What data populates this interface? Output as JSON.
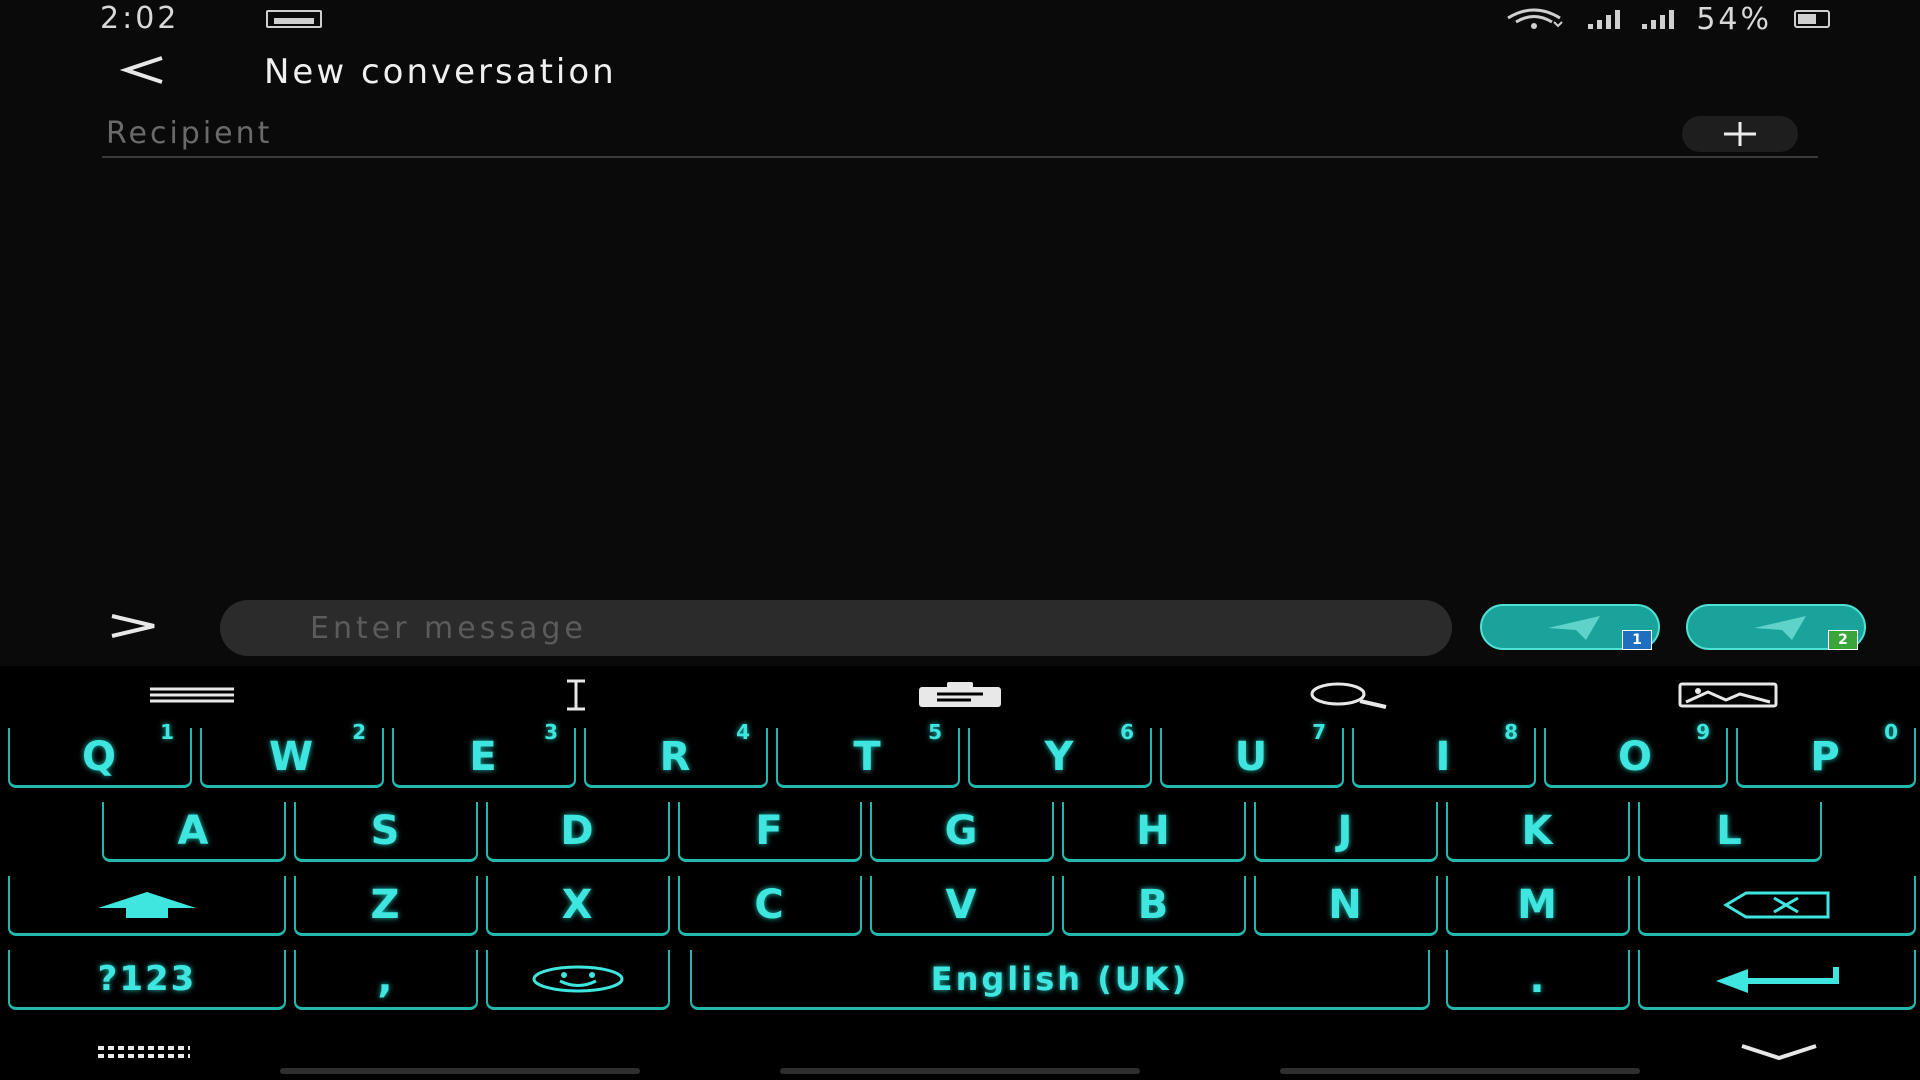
{
  "status_bar": {
    "time": "2:02",
    "battery": "54%",
    "icons": [
      "image-notification-icon",
      "wifi-icon",
      "signal-sim1-icon",
      "signal-sim2-icon",
      "battery-icon"
    ]
  },
  "header": {
    "title": "New conversation",
    "back_icon": "back-arrow-icon"
  },
  "recipient": {
    "placeholder": "Recipient",
    "add_icon": "plus-icon"
  },
  "composer": {
    "placeholder": "Enter message",
    "expand_icon": "chevron-right-icon",
    "send_buttons": [
      {
        "sim": "1",
        "icon": "send-icon",
        "badge_color": "#1f6fc0"
      },
      {
        "sim": "2",
        "icon": "send-icon",
        "badge_color": "#3aa53a"
      }
    ]
  },
  "keyboard": {
    "accent": "#3fe6df",
    "toolbar": [
      "menu-icon",
      "text-cursor-icon",
      "clipboard-icon",
      "search-icon",
      "image-icon"
    ],
    "row1": [
      {
        "label": "Q",
        "hint": "1"
      },
      {
        "label": "W",
        "hint": "2"
      },
      {
        "label": "E",
        "hint": "3"
      },
      {
        "label": "R",
        "hint": "4"
      },
      {
        "label": "T",
        "hint": "5"
      },
      {
        "label": "Y",
        "hint": "6"
      },
      {
        "label": "U",
        "hint": "7"
      },
      {
        "label": "I",
        "hint": "8"
      },
      {
        "label": "O",
        "hint": "9"
      },
      {
        "label": "P",
        "hint": "0"
      }
    ],
    "row2": [
      "A",
      "S",
      "D",
      "F",
      "G",
      "H",
      "J",
      "K",
      "L"
    ],
    "row3": [
      "Z",
      "X",
      "C",
      "V",
      "B",
      "N",
      "M"
    ],
    "row4": {
      "symbols": "?123",
      "comma": ",",
      "space": "English (UK)",
      "period": "."
    },
    "bottom": [
      "keyboard-switch-icon",
      "hide-keyboard-icon"
    ]
  }
}
